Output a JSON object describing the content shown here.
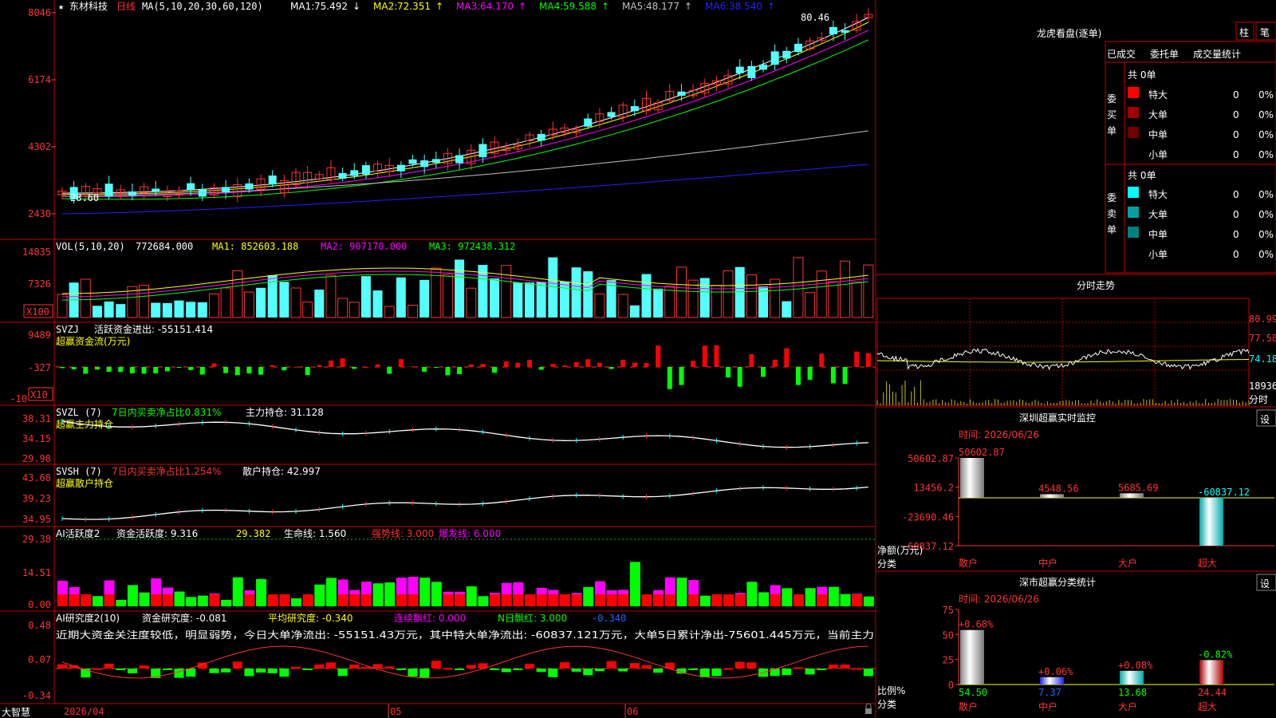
{
  "stock": {
    "name": "东材科技",
    "period": "日线"
  },
  "main_panel": {
    "header": {
      "star": "★",
      "ma_spec": "MA(5,10,20,30,60,120)"
    },
    "ma": [
      {
        "label": "MA1:",
        "value": "75.492",
        "arrow": "↓",
        "color": "#ffffff"
      },
      {
        "label": "MA2:",
        "value": "72.351",
        "arrow": "↑",
        "color": "#ffff00"
      },
      {
        "label": "MA3:",
        "value": "64.170",
        "arrow": "↑",
        "color": "#ff00ff"
      },
      {
        "label": "MA4:",
        "value": "59.588",
        "arrow": "↑",
        "color": "#00ff00"
      },
      {
        "label": "MA5:",
        "value": "48.177",
        "arrow": "↑",
        "color": "#c0c0c0"
      },
      {
        "label": "MA6:",
        "value": "38.540",
        "arrow": "↑",
        "color": "#2222ff"
      }
    ],
    "y_ticks": [
      "8046",
      "6174",
      "4302",
      "2430"
    ],
    "high_label": "80.46",
    "low_label": "28.60"
  },
  "vol_panel": {
    "header": "VOL(5,10,20)",
    "value": "772684.000",
    "ma1": "MA1: 852603.188",
    "ma2": "MA2: 907170.000",
    "ma3": "MA3: 972438.312",
    "y_ticks": [
      "14835",
      "7326"
    ],
    "unit": "X100"
  },
  "svzj_panel": {
    "name": "SVZJ",
    "desc": "活跃资金进出: -55151.414",
    "subtitle": "超赢资金流(万元)",
    "y_ticks": [
      "9489",
      "-327",
      "-10"
    ],
    "unit": "X10"
  },
  "svzl_panel": {
    "name": "SVZL (7)",
    "desc1": "7日内买卖净占比0.831%",
    "desc2": "主力持仓: 31.128",
    "subtitle": "超赢主力持仓",
    "y_ticks": [
      "38.31",
      "34.15",
      "29.98"
    ]
  },
  "svsh_panel": {
    "name": "SVSH (7)",
    "desc1": "7日内买卖净占比1.254%",
    "desc2": "散户持仓: 42.997",
    "subtitle": "超赢散户持仓",
    "y_ticks": [
      "43.68",
      "39.23",
      "34.95"
    ]
  },
  "ai_active_panel": {
    "name": "AI活跃度2",
    "d1": "资金活跃度: 9.316",
    "d2": "29.382",
    "d3": "生命线: 1.560",
    "d4": "强势线: 3.000",
    "d5": "爆发线: 6.000",
    "y_ticks": [
      "29.38",
      "14.51",
      "0.00"
    ]
  },
  "ai_research_panel": {
    "name": "AI研究度2(10)",
    "d1": "资金研究度: -0.081",
    "d2": "平均研究度: -0.340",
    "d3": "连续飘红: 0.000",
    "d4": "N日飘红: 3.000",
    "d5": "-0.340",
    "commentary": "近期大资金关注度较低，明显弱势，今日大单净流出: -55151.43万元，其中特大单净流出: -60837.121万元，大单5日累计净出-75601.445万元，当前主力",
    "y_ticks": [
      "0.48",
      "0.07",
      "-0.34"
    ]
  },
  "bottom_bar": {
    "brand": "大智慧",
    "date0": "2026/04",
    "m1": "05",
    "m2": "06"
  },
  "right": {
    "lhb_title": "龙虎看盘(逐单)",
    "btn_bar": "柱",
    "btn_bi": "笔",
    "tabs": [
      "已成交",
      "委托单",
      "成交量统计"
    ],
    "buy_label": "委买单",
    "sell_label": "委卖单",
    "buy_total": "共 0单",
    "sell_total": "共 0单",
    "buy_rows": [
      {
        "name": "特大",
        "count": "0",
        "pct": "0%",
        "color": "#ff0000"
      },
      {
        "name": "大单",
        "count": "0",
        "pct": "0%",
        "color": "#a00000"
      },
      {
        "name": "中单",
        "count": "0",
        "pct": "0%",
        "color": "#700000"
      },
      {
        "name": "小单",
        "count": "0",
        "pct": "0%",
        "color": "#000000"
      }
    ],
    "sell_rows": [
      {
        "name": "特大",
        "count": "0",
        "pct": "0%",
        "color": "#00ffff"
      },
      {
        "name": "大单",
        "count": "0",
        "pct": "0%",
        "color": "#00a0a0"
      },
      {
        "name": "中单",
        "count": "0",
        "pct": "0%",
        "color": "#008080"
      },
      {
        "name": "小单",
        "count": "0",
        "pct": "0%",
        "color": "#000000"
      }
    ],
    "intraday": {
      "title": "分时走势",
      "y_ticks": [
        "80.99",
        "77.58",
        "74.18"
      ],
      "vol_tick": "18936",
      "vol_unit": "分时"
    },
    "sz_monitor": {
      "title": "深圳超赢实时监控",
      "set": "设",
      "time": "时间: 2026/06/26",
      "y_ticks": [
        "50602.87",
        "13456.2",
        "-23690.46",
        "-60837.12"
      ],
      "axis_label": "净额(万元)",
      "cat_label": "分类",
      "chart_data": {
        "type": "bar",
        "categories": [
          "散户",
          "中户",
          "大户",
          "超大"
        ],
        "values": [
          50602.87,
          4548.56,
          5685.69,
          -60837.12
        ],
        "ylim": [
          -60837.12,
          50602.87
        ]
      }
    },
    "sz_class": {
      "title": "深市超赢分类统计",
      "set": "设",
      "time": "时间: 2026/06/26",
      "y_ticks": [
        "75",
        "50",
        "25",
        "0"
      ],
      "axis_label": "比例%",
      "cat_label": "分类",
      "chart_data": {
        "type": "bar",
        "categories": [
          "散户",
          "中户",
          "大户",
          "超大"
        ],
        "values": [
          54.5,
          7.37,
          13.68,
          24.44
        ],
        "changes": [
          "+0.68%",
          "+0.06%",
          "+0.08%",
          "-0.82%"
        ],
        "ylim": [
          0,
          75
        ]
      }
    }
  },
  "colors": {
    "up": "#ff3232",
    "down": "#54ffff",
    "grid": "#b00000",
    "axis": "#ff3232"
  }
}
